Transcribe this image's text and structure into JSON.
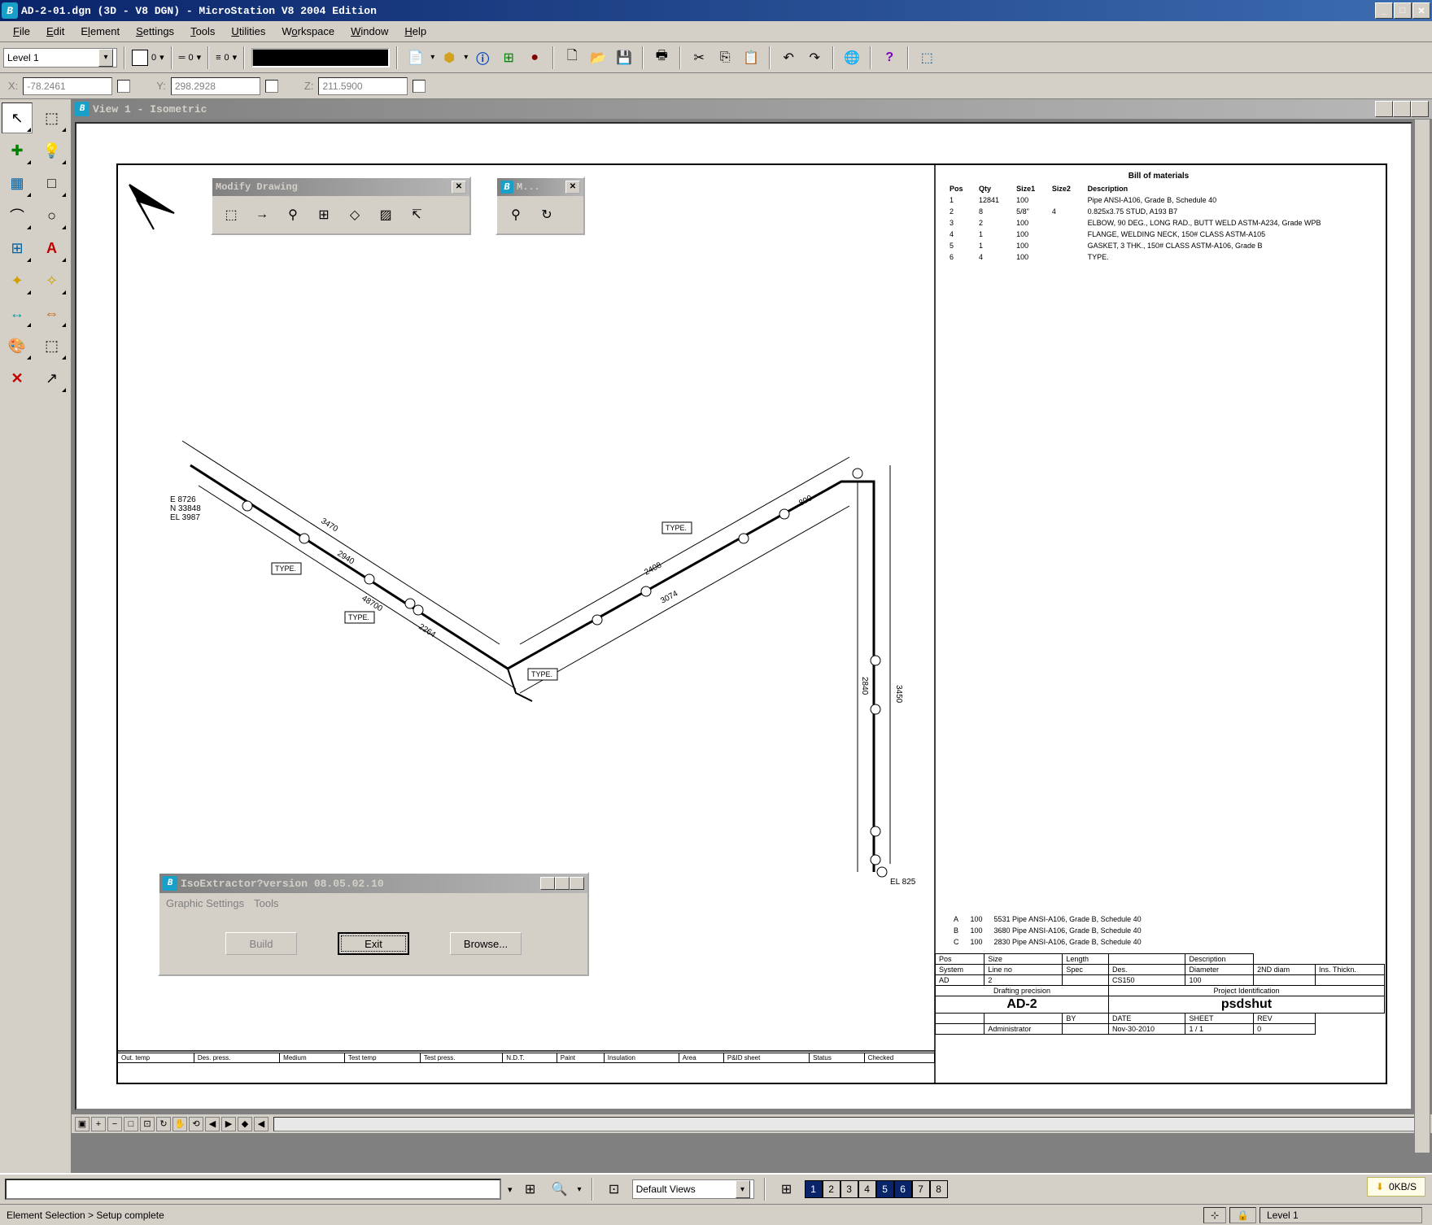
{
  "title": "AD-2-01.dgn (3D - V8 DGN) - MicroStation V8 2004 Edition",
  "menus": [
    "File",
    "Edit",
    "Element",
    "Settings",
    "Tools",
    "Utilities",
    "Workspace",
    "Window",
    "Help"
  ],
  "level_selector": "Level 1",
  "linestyle_num1": "0",
  "linestyle_num2": "0",
  "linestyle_num3": "0",
  "coords": {
    "x_label": "X:",
    "x": "-78.2461",
    "y_label": "Y:",
    "y": "298.2928",
    "z_label": "Z:",
    "z": "211.5900"
  },
  "view_window_title": "View 1 - Isometric",
  "modify_palette_title": "Modify Drawing",
  "small_palette_title": "M...",
  "iso_dialog": {
    "title": "IsoExtractor?version 08.05.02.10",
    "menus": [
      "Graphic Settings",
      "Tools"
    ],
    "build": "Build",
    "exit": "Exit",
    "browse": "Browse..."
  },
  "materials": {
    "header": "Bill of materials",
    "cols": [
      "Pos",
      "Qty",
      "Size1",
      "Size2",
      "Description"
    ],
    "rows": [
      [
        "1",
        "12841",
        "100",
        "",
        "Pipe ANSI-A106, Grade B, Schedule 40"
      ],
      [
        "2",
        "8",
        "5/8\"",
        "4",
        "0.825x3.75 STUD, A193 B7"
      ],
      [
        "3",
        "2",
        "100",
        "",
        "ELBOW, 90 DEG., LONG RAD., BUTT WELD ASTM-A234, Grade WPB"
      ],
      [
        "4",
        "1",
        "100",
        "",
        "FLANGE, WELDING NECK, 150# CLASS ASTM-A105"
      ],
      [
        "5",
        "1",
        "100",
        "",
        "GASKET, 3 THK., 150# CLASS ASTM-A106, Grade B"
      ],
      [
        "6",
        "4",
        "100",
        "",
        "TYPE."
      ]
    ]
  },
  "cut_pipes": [
    [
      "A",
      "100",
      "5531 Pipe ANSI-A106, Grade B, Schedule 40"
    ],
    [
      "B",
      "100",
      "3680 Pipe ANSI-A106, Grade B, Schedule 40"
    ],
    [
      "C",
      "100",
      "2830 Pipe ANSI-A106, Grade B, Schedule 40"
    ]
  ],
  "titleblock": {
    "row1": [
      "Pos",
      "Size",
      "Length",
      "",
      "Description"
    ],
    "row2": [
      "System",
      "Line no",
      "Spec",
      "Des.",
      "Diameter",
      "2ND diam",
      "Ins. Thickn."
    ],
    "row3": [
      "AD",
      "2",
      "",
      "CS150",
      "100",
      "",
      ""
    ],
    "row4_left": "Drafting precision",
    "row4_right": "Project Identification",
    "ad2": "AD-2",
    "project": "psdshut",
    "row6": [
      "",
      "",
      "BY",
      "DATE",
      "SHEET",
      "REV"
    ],
    "row7": [
      "",
      "Administrator",
      "",
      "Nov-30-2010",
      "1 / 1",
      "0"
    ]
  },
  "drawing_footer_cols": [
    "Out. temp",
    "Des. press.",
    "Medium",
    "Test temp",
    "Test press.",
    "N.D.T.",
    "Paint",
    "Insulation",
    "Area",
    "P&ID sheet",
    "Status",
    "Checked"
  ],
  "drawing_labels": {
    "coord1": "E 8726\nN 33848\nEL 3987",
    "bottom_el": "EL 825"
  },
  "bottom": {
    "default_views": "Default Views",
    "tabs": [
      "1",
      "2",
      "3",
      "4",
      "5",
      "6",
      "7",
      "8"
    ]
  },
  "status_text": "Element Selection > Setup complete",
  "status_level": "Level 1",
  "kbs": "0KB/S"
}
